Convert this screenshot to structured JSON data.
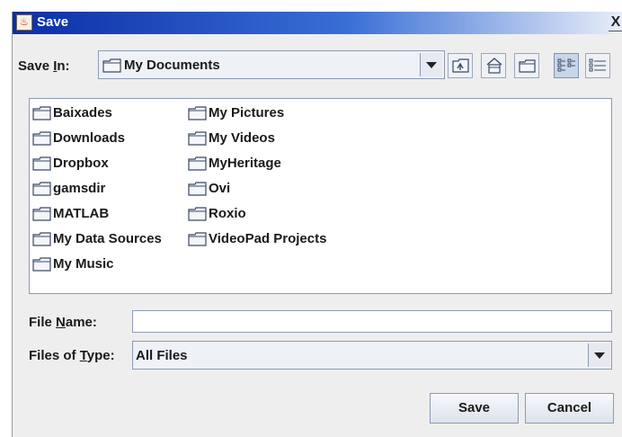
{
  "window": {
    "title": "Save",
    "close_glyph": "X"
  },
  "save_in": {
    "label_prefix": "Save ",
    "label_key": "I",
    "label_suffix": "n:",
    "value": "My Documents"
  },
  "toolbar": {
    "icons": [
      "up-one-level-icon",
      "home-icon",
      "new-folder-icon",
      "list-view-icon",
      "details-view-icon"
    ]
  },
  "files": {
    "col1": [
      "Baixades",
      "Downloads",
      "Dropbox",
      "gamsdir",
      "MATLAB",
      "My Data Sources",
      "My Music"
    ],
    "col2": [
      "My Pictures",
      "My Videos",
      "MyHeritage",
      "Ovi",
      "Roxio",
      "VideoPad Projects"
    ]
  },
  "file_name": {
    "label_prefix": "File ",
    "label_key": "N",
    "label_suffix": "ame:",
    "value": ""
  },
  "file_type": {
    "label_prefix": "Files of ",
    "label_key": "T",
    "label_suffix": "ype:",
    "value": "All Files"
  },
  "buttons": {
    "save": "Save",
    "cancel": "Cancel"
  },
  "colors": {
    "title_blue": "#0b2ea6",
    "panel": "#eeeeee",
    "border": "#8b9ab4"
  }
}
